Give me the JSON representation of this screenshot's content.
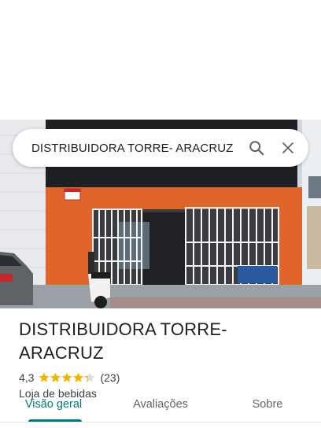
{
  "search": {
    "query": "DISTRIBUIDORA TORRE- ARACRUZ"
  },
  "place": {
    "name": "DISTRIBUIDORA TORRE- ARACRUZ",
    "rating": "4,3",
    "rating_value": 4.3,
    "review_count": "(23)",
    "category": "Loja de bebidas"
  },
  "photo": {
    "sign_text": "AVISO"
  },
  "tabs": [
    {
      "label": "Visão geral",
      "active": true
    },
    {
      "label": "Avaliações",
      "active": false
    },
    {
      "label": "Sobre",
      "active": false
    }
  ],
  "colors": {
    "accent": "#017a7a",
    "star": "#f4b400",
    "facade_orange": "#e0652a"
  },
  "icons": [
    "search-icon",
    "close-icon",
    "star-icon"
  ]
}
